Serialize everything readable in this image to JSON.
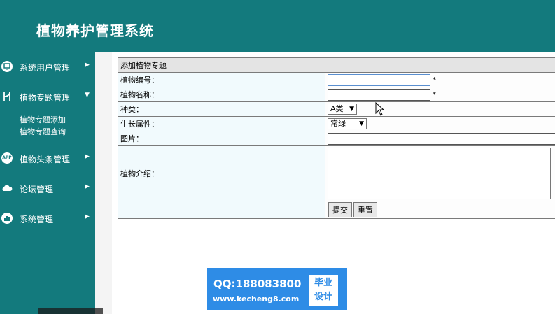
{
  "header": {
    "title": "植物养护管理系统"
  },
  "sidebar": {
    "items": [
      {
        "label": "系统用户管理",
        "icon": "monitor-icon"
      },
      {
        "label": "植物专题管理",
        "icon": "branch-icon",
        "expanded": true,
        "children": [
          "植物专题添加",
          "植物专题查询"
        ]
      },
      {
        "label": "植物头条管理",
        "icon": "app-icon",
        "icon_text": "APP"
      },
      {
        "label": "论坛管理",
        "icon": "cloud-icon"
      },
      {
        "label": "系统管理",
        "icon": "chart-icon"
      }
    ]
  },
  "form": {
    "title": "添加植物专题",
    "fields": {
      "code_label": "植物编号：",
      "name_label": "植物名称：",
      "category_label": "种类：",
      "category_value": "A类",
      "growth_label": "生长属性：",
      "growth_value": "常绿",
      "image_label": "图片：",
      "intro_label": "植物介绍：",
      "required_mark": "*"
    },
    "buttons": {
      "submit": "提交",
      "reset": "重置"
    }
  },
  "watermark": {
    "qq": "QQ:188083800",
    "site": "www.kecheng8.com",
    "badge_line1": "毕业",
    "badge_line2": "设计"
  },
  "colors": {
    "primary": "#137a7d",
    "banner": "#2e8ce6"
  }
}
